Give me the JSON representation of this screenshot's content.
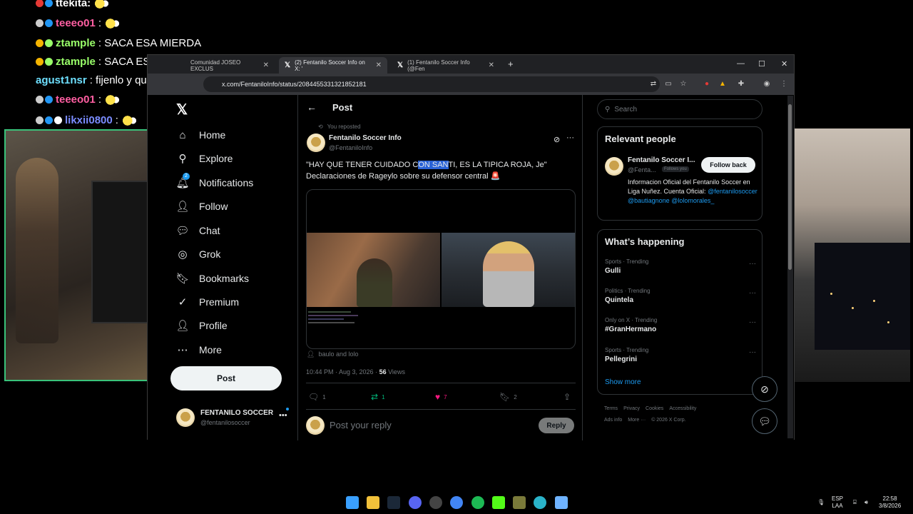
{
  "chat": [
    {
      "user": "ttekita:",
      "message": "",
      "color": "#ffffff"
    },
    {
      "user": "teeeo01",
      "message": ":",
      "color": "#ff5fa2"
    },
    {
      "user": "ztample",
      "message": ": SACA ESA MIERDA",
      "color": "#9aff6a"
    },
    {
      "user": "ztample",
      "message": ": SACA ESA MIERDA",
      "color": "#9aff6a"
    },
    {
      "user": "agust1nsr",
      "message": ": fijenlo y queda escrachado",
      "color": "#6ee0ff"
    },
    {
      "user": "teeeo01",
      "message": ":",
      "color": "#ff5fa2"
    },
    {
      "user": "likxii0800",
      "message": ":",
      "color": "#7a8cff"
    }
  ],
  "browser": {
    "tabs": [
      {
        "label": "Comunidad JOSEO EXCLUS"
      },
      {
        "label": "(2) Fentanilo Soccer Info on X: '"
      },
      {
        "label": "(1) Fentanilo Soccer Info (@Fen"
      }
    ],
    "new_tab": "+",
    "minimize": "—",
    "maximize": "☐",
    "close": "✕",
    "url": "x.com/FentaniloInfo/status/2084455331321852181"
  },
  "nav": {
    "brand": "𝕏",
    "items": [
      {
        "label": "Home",
        "icon": "⌂"
      },
      {
        "label": "Explore",
        "icon": "⚲"
      },
      {
        "label": "Notifications",
        "icon": "🔔︎",
        "badge": "2"
      },
      {
        "label": "Follow",
        "icon": "👤︎"
      },
      {
        "label": "Chat",
        "icon": "💬︎"
      },
      {
        "label": "Grok",
        "icon": "◎"
      },
      {
        "label": "Bookmarks",
        "icon": "🔖︎"
      },
      {
        "label": "Premium",
        "icon": "✓"
      },
      {
        "label": "Profile",
        "icon": "👤︎"
      },
      {
        "label": "More",
        "icon": "⋯"
      }
    ],
    "post_label": "Post",
    "account": {
      "name": "FENTANILO SOCCER",
      "handle": "@fentanilosoccer",
      "more": "•••"
    }
  },
  "main": {
    "header_title": "Post",
    "back": "←",
    "reposted": "You reposted",
    "author_name": "Fentanilo Soccer Info",
    "author_handle": "@FentaniloInfo",
    "text_before": "\"HAY QUE TENER CUIDADO C",
    "text_highlight": "ON SAN",
    "text_after": "TI, ES LA TIPICA ROJA, Je\"",
    "text_line2": "Declaraciones de Rageylo sobre su defensor central 🚨",
    "media_caption": "baulo and lolo",
    "time": "10:44 PM · Aug 3, 2026 · ",
    "views_count": "56",
    "views_label": " Views",
    "actions": {
      "reply": "1",
      "retweet": "1",
      "like": "7",
      "bookmark": "2"
    },
    "reply_placeholder": "Post your reply",
    "reply_button": "Reply"
  },
  "sidebar": {
    "search_placeholder": "Search",
    "relevant_title": "Relevant people",
    "person": {
      "name": "Fentanilo Soccer I...",
      "handle": "@Fenta...",
      "follows_you": "Follows you",
      "follow_button": "Follow back",
      "bio_text": "Informacion Oficial del Fentanilo Soccer en Liga Nuñez. Cuenta Oficial: ",
      "bio_link1": "@fentanilosoccer",
      "bio_link2": "@bautiagnone",
      "bio_link3": "@lolomorales_"
    },
    "happening_title": "What’s happening",
    "trends": [
      {
        "category": "Sports · Trending",
        "name": "Gulli"
      },
      {
        "category": "Politics · Trending",
        "name": "Quintela"
      },
      {
        "category": "Only on X · Trending",
        "name": "#GranHermano"
      },
      {
        "category": "Sports · Trending",
        "name": "Pellegrini"
      }
    ],
    "show_more": "Show more",
    "footer": [
      "Terms",
      "Privacy",
      "Cookies",
      "Accessibility",
      "Ads info",
      "More ···",
      "© 2026 X Corp."
    ]
  },
  "taskbar": {
    "lang_top": "ESP",
    "lang_bottom": "LAA",
    "time": "22:58",
    "date": "3/8/2026"
  }
}
